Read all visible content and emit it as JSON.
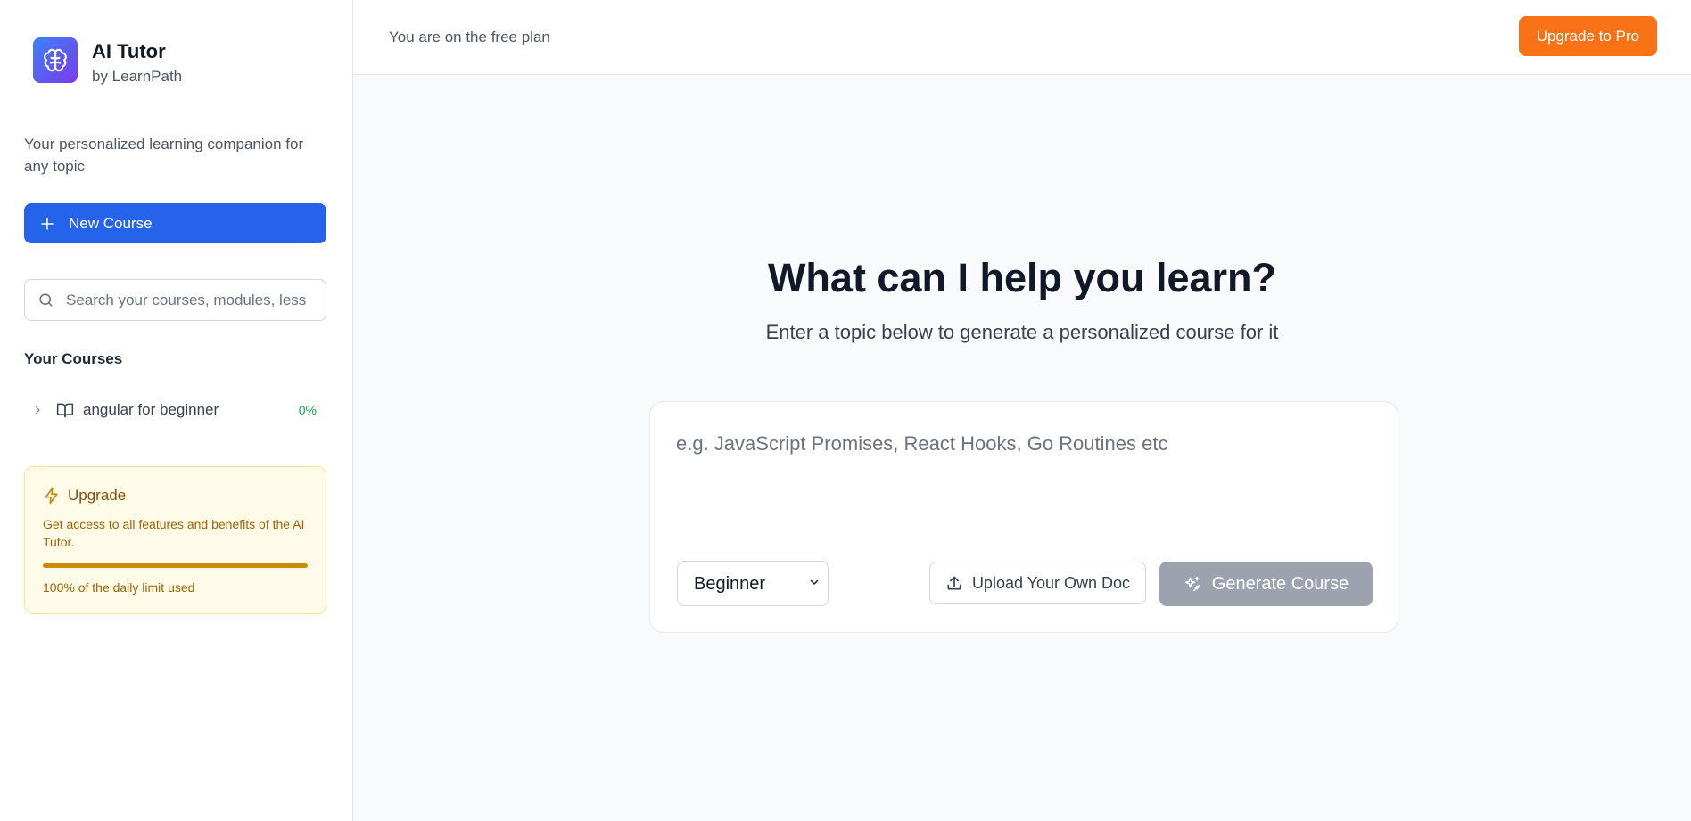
{
  "brand": {
    "title": "AI Tutor",
    "subtitle": "by LearnPath",
    "logo_icon": "brain-icon"
  },
  "sidebar": {
    "tagline": "Your personalized learning companion for any topic",
    "new_course_label": "New Course",
    "search_placeholder": "Search your courses, modules, lessons",
    "courses_heading": "Your Courses",
    "courses": [
      {
        "name": "angular for beginner",
        "progress": "0%"
      }
    ],
    "upgrade": {
      "title": "Upgrade",
      "description": "Get access to all features and benefits of the AI Tutor.",
      "usage_text": "100% of the daily limit used",
      "usage_fraction": 1.0
    }
  },
  "topbar": {
    "plan_text": "You are on the free plan",
    "upgrade_button": "Upgrade to Pro"
  },
  "main": {
    "heading": "What can I help you learn?",
    "subheading": "Enter a topic below to generate a personalized course for it",
    "topic_placeholder": "e.g. JavaScript Promises, React Hooks, Go Routines etc",
    "level_selected": "Beginner",
    "level_options": [
      "Beginner"
    ],
    "upload_label": "Upload Your Own Doc",
    "generate_label": "Generate Course"
  },
  "colors": {
    "primary": "#2563eb",
    "accent_orange": "#f97316",
    "disabled_gray": "#9ca3af",
    "progress_green": "#16a34a",
    "upgrade_bg": "#fefce8"
  }
}
